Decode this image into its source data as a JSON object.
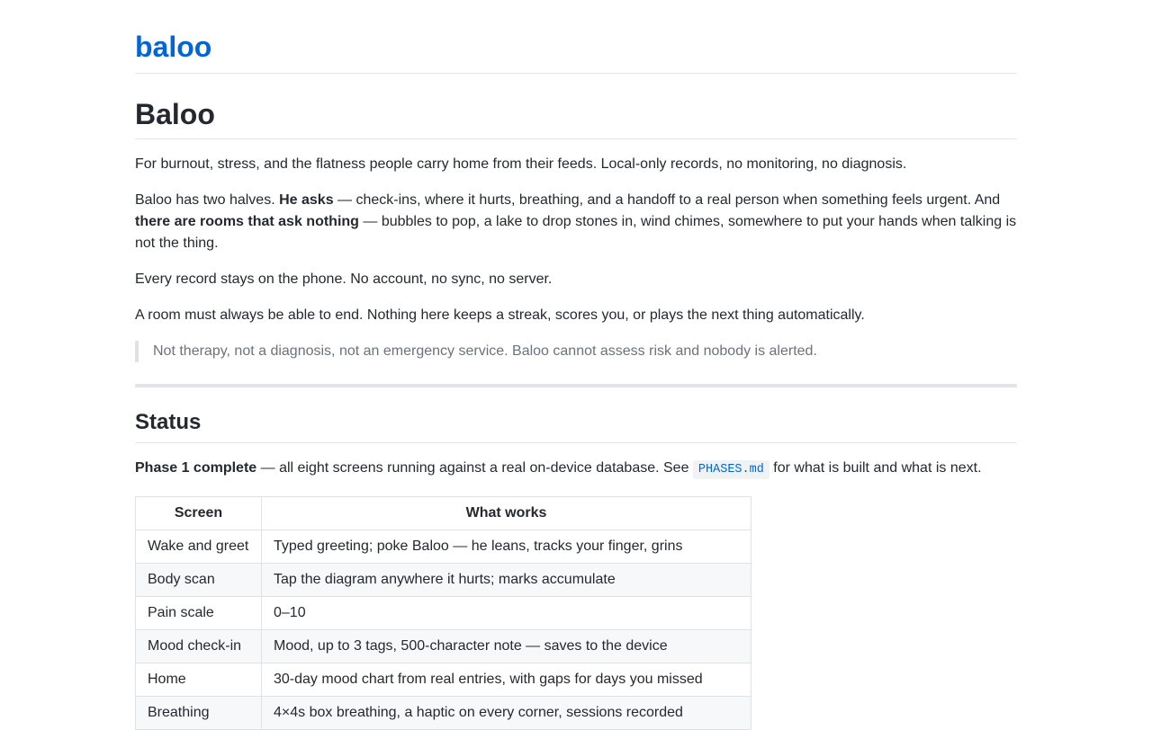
{
  "site": {
    "title": "baloo"
  },
  "page": {
    "heading": "Baloo",
    "intro": "For burnout, stress, and the flatness people carry home from their feeds. Local-only records, no monitoring, no diagnosis.",
    "halves": {
      "lead": "Baloo has two halves. ",
      "asks_bold": "He asks",
      "asks_rest": " — check-ins, where it hurts, breathing, and a handoff to a real person when something feels urgent. And ",
      "rooms_bold": "there are rooms that ask nothing",
      "rooms_rest": " — bubbles to pop, a lake to drop stones in, wind chimes, somewhere to put your hands when talking is not the thing."
    },
    "record": "Every record stays on the phone. No account, no sync, no server.",
    "room_end": "A room must always be able to end. Nothing here keeps a streak, scores you, or plays the next thing automatically.",
    "disclaimer": "Not therapy, not a diagnosis, not an emergency service. Baloo cannot assess risk and nobody is alerted."
  },
  "status": {
    "heading": "Status",
    "phase_bold": "Phase 1 complete",
    "phase_rest": " — all eight screens running against a real on-device database. See ",
    "phases_file": "PHASES.md",
    "phase_tail": " for what is built and what is next.",
    "table": {
      "headers": [
        "Screen",
        "What works"
      ],
      "rows": [
        [
          "Wake and greet",
          "Typed greeting; poke Baloo — he leans, tracks your finger, grins"
        ],
        [
          "Body scan",
          "Tap the diagram anywhere it hurts; marks accumulate"
        ],
        [
          "Pain scale",
          "0–10"
        ],
        [
          "Mood check-in",
          "Mood, up to 3 tags, 500-character note — saves to the device"
        ],
        [
          "Home",
          "30-day mood chart from real entries, with gaps for days you missed"
        ],
        [
          "Breathing",
          "4×4s box breathing, a haptic on every corner, sessions recorded"
        ]
      ]
    }
  }
}
